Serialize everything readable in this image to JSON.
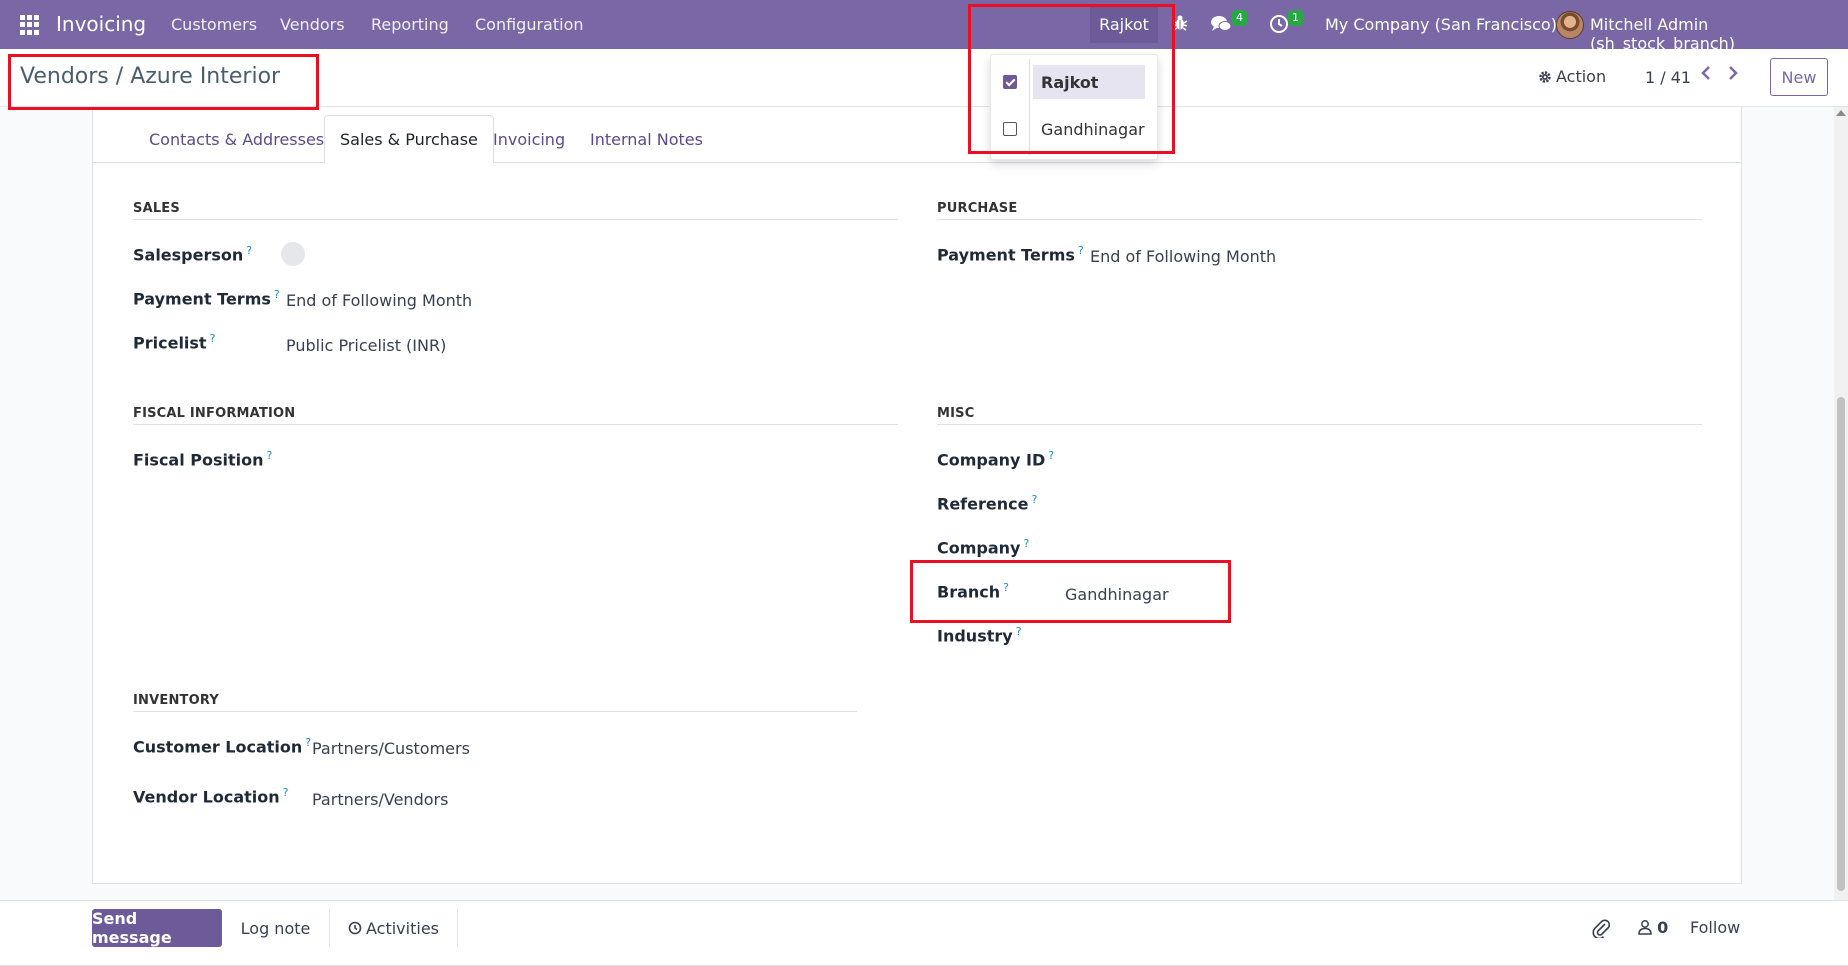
{
  "navbar": {
    "app_name": "Invoicing",
    "menu": [
      "Customers",
      "Vendors",
      "Reporting",
      "Configuration"
    ],
    "branch_toggle": "Rajkot",
    "messages_count": "4",
    "activities_count": "1",
    "company": "My Company (San Francisco)",
    "user": "Mitchell Admin (sh_stock_branch)",
    "icons": {
      "apps": "apps-grid-icon",
      "debug": "bug-icon",
      "messages": "chat-icon",
      "activities": "clock-icon"
    }
  },
  "branch_dropdown": {
    "items": [
      {
        "label": "Rajkot",
        "checked": true
      },
      {
        "label": "Gandhinagar",
        "checked": false
      }
    ]
  },
  "control_panel": {
    "breadcrumb_parent": "Vendors",
    "breadcrumb_separator": "/",
    "breadcrumb_current": "Azure Interior",
    "action_label": "Action",
    "pager": "1 / 41",
    "new_label": "New"
  },
  "tabs": [
    "Contacts & Addresses",
    "Sales & Purchase",
    "Invoicing",
    "Internal Notes"
  ],
  "active_tab": "Sales & Purchase",
  "sales": {
    "title": "SALES",
    "salesperson_label": "Salesperson",
    "payment_terms_label": "Payment Terms",
    "payment_terms_value": "End of Following Month",
    "pricelist_label": "Pricelist",
    "pricelist_value": "Public Pricelist (INR)"
  },
  "purchase": {
    "title": "PURCHASE",
    "payment_terms_label": "Payment Terms",
    "payment_terms_value": "End of Following Month"
  },
  "fiscal": {
    "title": "FISCAL INFORMATION",
    "fiscal_position_label": "Fiscal Position"
  },
  "misc": {
    "title": "MISC",
    "company_id_label": "Company ID",
    "reference_label": "Reference",
    "company_label": "Company",
    "branch_label": "Branch",
    "branch_value": "Gandhinagar",
    "industry_label": "Industry"
  },
  "inventory": {
    "title": "INVENTORY",
    "customer_location_label": "Customer Location",
    "customer_location_value": "Partners/Customers",
    "vendor_location_label": "Vendor Location",
    "vendor_location_value": "Partners/Vendors"
  },
  "help_mark": "?",
  "chatter": {
    "send_message": "Send message",
    "log_note": "Log note",
    "activities": "Activities",
    "followers_count": "0",
    "follow": "Follow"
  },
  "colors": {
    "navbar": "#7a67a6",
    "accent": "#6d5a98",
    "highlight": "#e81123",
    "badge": "#28a745"
  }
}
